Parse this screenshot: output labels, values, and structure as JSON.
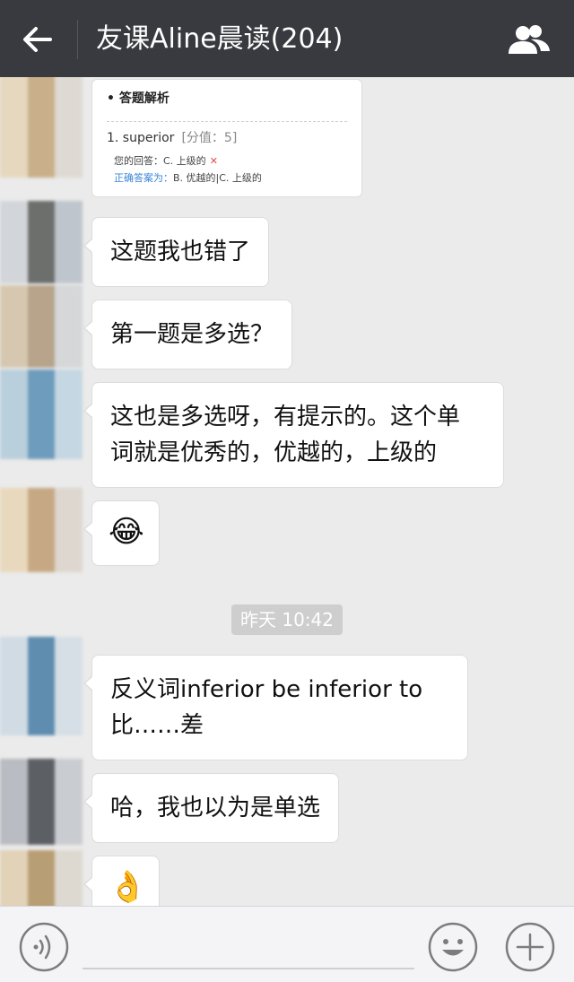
{
  "header": {
    "title": "友课Aline晨读(204)"
  },
  "card": {
    "heading": "• 答题解析",
    "question": "1. superior",
    "score": "[分值：5]",
    "your_answer": "您的回答：C. 上级的",
    "wrong_mark": "✕",
    "correct_label": "正确答案为：",
    "correct_value": "B. 优越的|C. 上级的"
  },
  "messages": [
    {
      "text": "这题我也错了"
    },
    {
      "text": "第一题是多选？"
    },
    {
      "text_line1": "这也是多选呀，有提示的。这个单",
      "text_line2": "词就是优秀的，优越的，上级的"
    },
    {
      "emoji": "😂"
    },
    {
      "text_line1": "反义词inferior  be inferior to",
      "text_line2": "比……差"
    },
    {
      "text": "哈，我也以为是单选"
    },
    {
      "emoji": "👌"
    }
  ],
  "timestamp": "昨天 10:42",
  "colors": {
    "header_bg": "#393a3f",
    "chat_bg": "#ebebeb",
    "bubble_bg": "#ffffff"
  }
}
